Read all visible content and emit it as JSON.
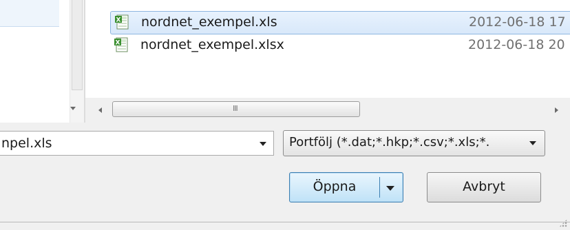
{
  "file_list": {
    "rows": [
      {
        "name": "nordnet_exempel.xls",
        "date": "2012-06-18 17",
        "icon": "excel-file-icon",
        "selected": true
      },
      {
        "name": "nordnet_exempel.xlsx",
        "date": "2012-06-18 20",
        "icon": "excel-file-icon",
        "selected": false
      }
    ]
  },
  "scrollbar": {
    "grip": "III"
  },
  "filename_field": {
    "value": "npel.xls"
  },
  "filetype_filter": {
    "value": "Portfölj (*.dat;*.hkp;*.csv;*.xls;*."
  },
  "buttons": {
    "open_label": "Öppna",
    "cancel_label": "Avbryt"
  },
  "colors": {
    "selection": "#d8e8fa",
    "open_button": "#bfe2f7",
    "excel_green": "#3a8f2f"
  }
}
